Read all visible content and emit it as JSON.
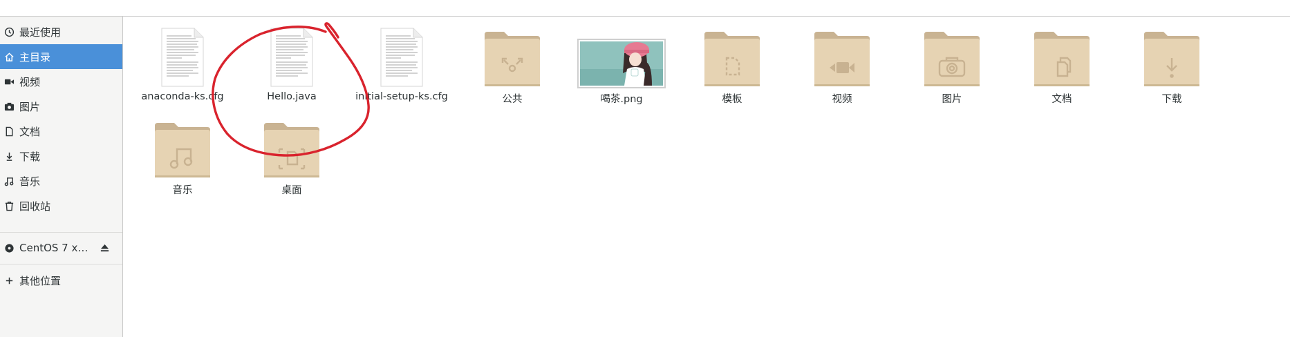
{
  "sidebar": {
    "items": [
      {
        "label": "最近使用",
        "icon": "clock-icon"
      },
      {
        "label": "主目录",
        "icon": "home-icon",
        "selected": true
      },
      {
        "label": "视频",
        "icon": "video-icon"
      },
      {
        "label": "图片",
        "icon": "camera-icon"
      },
      {
        "label": "文档",
        "icon": "document-icon"
      },
      {
        "label": "下载",
        "icon": "download-icon"
      },
      {
        "label": "音乐",
        "icon": "music-icon"
      },
      {
        "label": "回收站",
        "icon": "trash-icon"
      }
    ],
    "device": {
      "label": "CentOS 7 x…",
      "icon": "disc-icon",
      "eject_icon": "eject-icon"
    },
    "other": {
      "label": "其他位置",
      "icon": "plus-icon"
    }
  },
  "files": [
    {
      "name": "anaconda-ks.cfg",
      "kind": "text-file"
    },
    {
      "name": "Hello.java",
      "kind": "text-file"
    },
    {
      "name": "initial-setup-ks.cfg",
      "kind": "text-file"
    },
    {
      "name": "公共",
      "kind": "folder",
      "emblem": "share-icon"
    },
    {
      "name": "喝茶.png",
      "kind": "image"
    },
    {
      "name": "模板",
      "kind": "folder",
      "emblem": "template-icon"
    },
    {
      "name": "视频",
      "kind": "folder",
      "emblem": "video-icon"
    },
    {
      "name": "图片",
      "kind": "folder",
      "emblem": "camera-icon"
    },
    {
      "name": "文档",
      "kind": "folder",
      "emblem": "documents-icon"
    },
    {
      "name": "下载",
      "kind": "folder",
      "emblem": "download-icon"
    },
    {
      "name": "音乐",
      "kind": "folder",
      "emblem": "music-icon"
    },
    {
      "name": "桌面",
      "kind": "folder",
      "emblem": "desktop-icon"
    }
  ],
  "colors": {
    "selection": "#4a90d9",
    "folder": "#e6d3b3",
    "folder_tab": "#c9b392",
    "annotation": "#d9232d"
  }
}
